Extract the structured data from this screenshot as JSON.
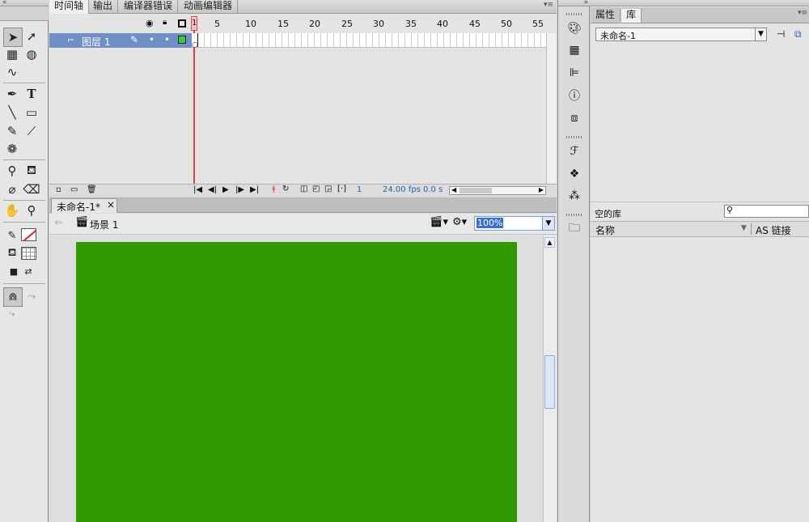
{
  "tools_panel": {
    "tools": [
      {
        "name": "selection-tool-icon",
        "glyph": "➤"
      },
      {
        "name": "subselection-tool-icon",
        "glyph": "➚"
      },
      {
        "name": "free-transform-tool-icon",
        "glyph": "▦"
      },
      {
        "name": "3d-rotation-tool-icon",
        "glyph": "◍"
      },
      {
        "name": "lasso-tool-icon",
        "glyph": "∿"
      },
      {
        "name": "pen-tool-icon",
        "glyph": "✒"
      },
      {
        "name": "text-tool-icon",
        "glyph": "T"
      },
      {
        "name": "line-tool-icon",
        "glyph": "╲"
      },
      {
        "name": "rectangle-tool-icon",
        "glyph": "▭"
      },
      {
        "name": "pencil-tool-icon",
        "glyph": "✎"
      },
      {
        "name": "brush-tool-icon",
        "glyph": "🖌"
      },
      {
        "name": "deco-tool-icon",
        "glyph": "❁"
      },
      {
        "name": "bone-tool-icon",
        "glyph": "⚲"
      },
      {
        "name": "paint-bucket-tool-icon",
        "glyph": "⛾"
      },
      {
        "name": "eyedropper-tool-icon",
        "glyph": "⌀"
      },
      {
        "name": "eraser-tool-icon",
        "glyph": "⌫"
      },
      {
        "name": "hand-tool-icon",
        "glyph": "✋"
      },
      {
        "name": "zoom-tool-icon",
        "glyph": "🔍"
      }
    ]
  },
  "timeline": {
    "tabs": [
      {
        "label": "时间轴",
        "active": true
      },
      {
        "label": "输出",
        "active": false
      },
      {
        "label": "编译器错误",
        "active": false
      },
      {
        "label": "动画编辑器",
        "active": false
      }
    ],
    "frame_numbers": [
      "1",
      "5",
      "10",
      "15",
      "20",
      "25",
      "30",
      "35",
      "40",
      "45",
      "50",
      "55"
    ],
    "layer_name": "图层 1",
    "current_frame": "1",
    "fps": "24.00 fps",
    "time": "0.0 s"
  },
  "document": {
    "tab_label": "未命名-1*",
    "close_glyph": "×",
    "scene_label": "场景 1",
    "zoom_value": "100%",
    "stage_color": "#339900"
  },
  "right_panel": {
    "tabs": [
      {
        "label": "属性",
        "active": false
      },
      {
        "label": "库",
        "active": true
      }
    ],
    "library_doc": "未命名-1",
    "empty_library": "空的库",
    "search_placeholder": "",
    "col_name": "名称",
    "col_linkage": "AS 链接"
  },
  "colors": {
    "panel_bg": "#e4e4e4",
    "selected_layer": "#6f8fc7",
    "playhead": "#e0404a",
    "keyframe_green": "#33cc33"
  }
}
